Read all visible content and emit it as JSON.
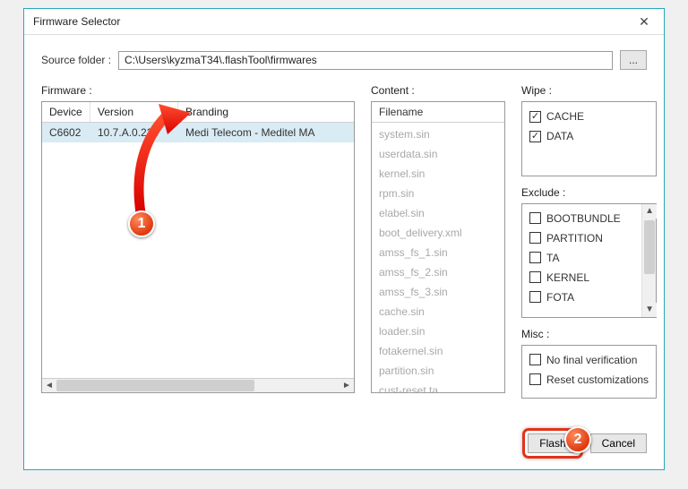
{
  "window": {
    "title": "Firmware Selector"
  },
  "source": {
    "label": "Source folder :",
    "path": "C:\\Users\\kyzmaT34\\.flashTool\\firmwares",
    "browse": "..."
  },
  "firmware": {
    "label": "Firmware :",
    "headers": {
      "device": "Device",
      "version": "Version",
      "branding": "Branding"
    },
    "row": {
      "device": "C6602",
      "version": "10.7.A.0.228",
      "branding": "Medi Telecom - Meditel MA"
    }
  },
  "content": {
    "label": "Content :",
    "header": "Filename",
    "items": [
      "system.sin",
      "userdata.sin",
      "kernel.sin",
      "rpm.sin",
      "elabel.sin",
      "boot_delivery.xml",
      "amss_fs_1.sin",
      "amss_fs_2.sin",
      "amss_fs_3.sin",
      "cache.sin",
      "loader.sin",
      "fotakernel.sin",
      "partition.sin",
      "cust-reset.ta"
    ]
  },
  "wipe": {
    "label": "Wipe :",
    "items": [
      {
        "label": "CACHE",
        "checked": true
      },
      {
        "label": "DATA",
        "checked": true
      }
    ]
  },
  "exclude": {
    "label": "Exclude :",
    "items": [
      {
        "label": "BOOTBUNDLE",
        "checked": false
      },
      {
        "label": "PARTITION",
        "checked": false
      },
      {
        "label": "TA",
        "checked": false
      },
      {
        "label": "KERNEL",
        "checked": false
      },
      {
        "label": "FOTA",
        "checked": false
      }
    ]
  },
  "misc": {
    "label": "Misc :",
    "items": [
      {
        "label": "No final verification",
        "checked": false
      },
      {
        "label": "Reset customizations",
        "checked": false
      }
    ]
  },
  "footer": {
    "flash": "Flash",
    "cancel": "Cancel"
  },
  "annotations": {
    "marker1": "1",
    "marker2": "2"
  }
}
